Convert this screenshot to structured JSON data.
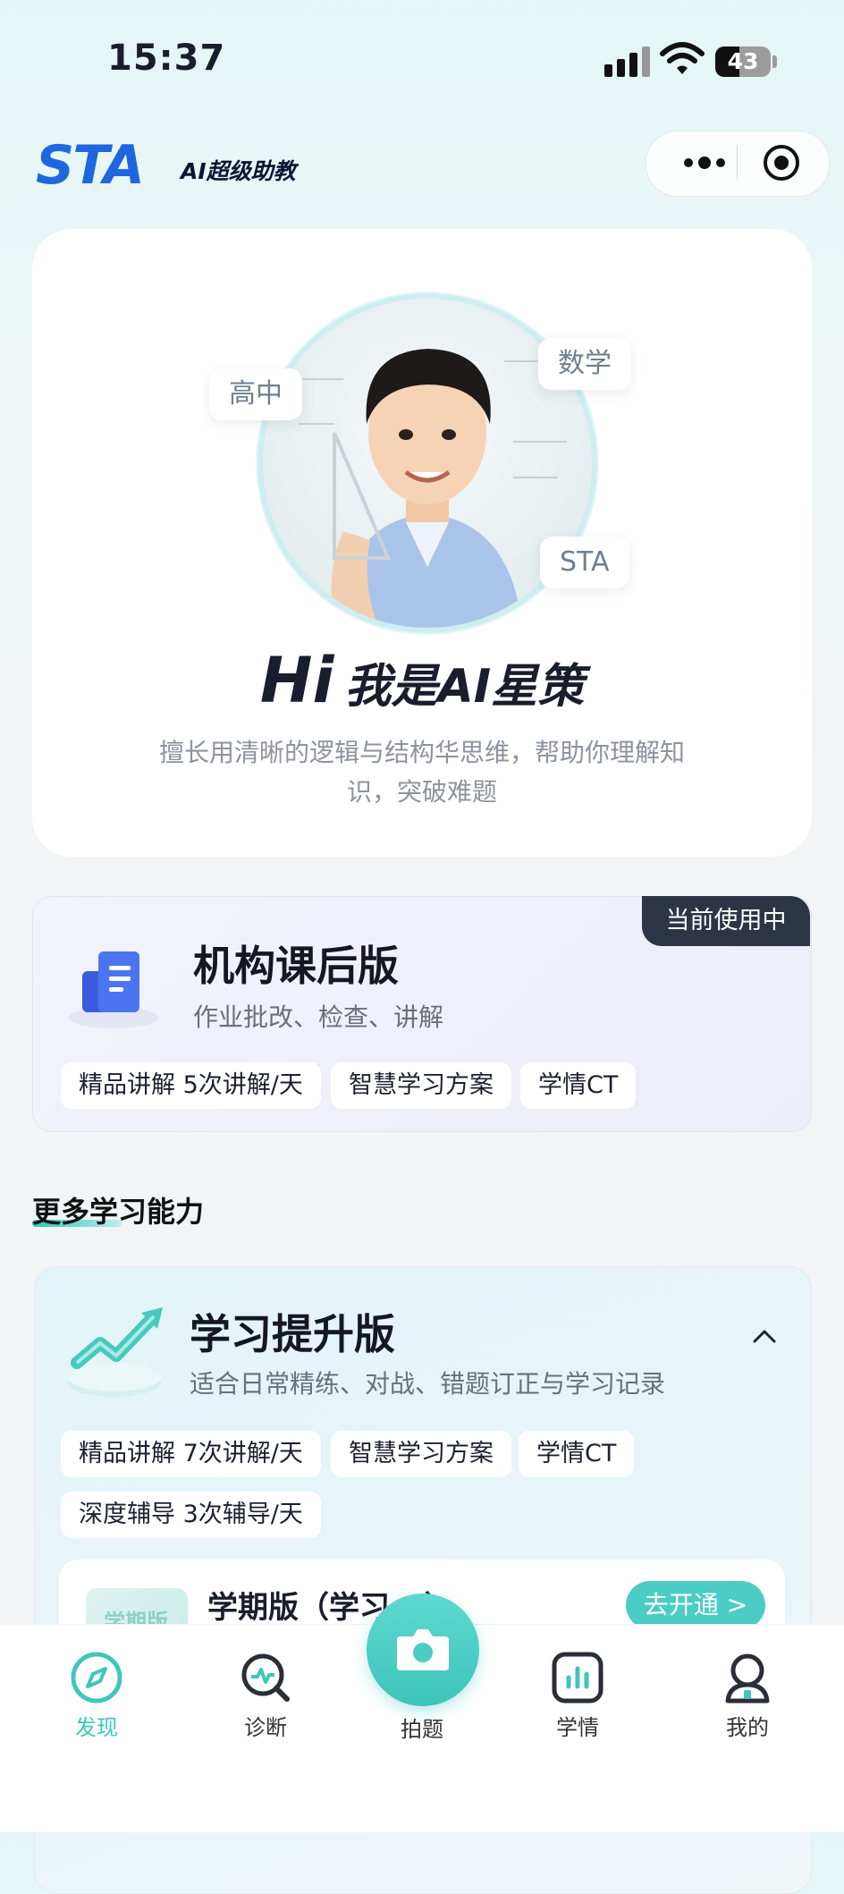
{
  "status_bar": {
    "time": "15:37",
    "battery": "43"
  },
  "header": {
    "logo": "STA",
    "logo_subtitle": "AI超级助教"
  },
  "hero": {
    "tags": [
      "高中",
      "数学",
      "STA"
    ],
    "greeting_hi": "Hi",
    "greeting_name": "我是AI星策",
    "description": "擅长用清晰的逻辑与结构华思维，帮助你理解知识，突破难题"
  },
  "org_plan": {
    "badge": "当前使用中",
    "title": "机构课后版",
    "subtitle": "作业批改、检查、讲解",
    "chips": [
      "精品讲解 5次讲解/天",
      "智慧学习方案",
      "学情CT"
    ]
  },
  "section": {
    "title": "更多学习能力"
  },
  "study_plan": {
    "title": "学习提升版",
    "subtitle": "适合日常精练、对战、错题订正与学习记录",
    "chips": [
      "精品讲解 7次讲解/天",
      "智慧学习方案",
      "学情CT",
      "深度辅导 3次辅导/天"
    ],
    "option": {
      "book_label": "学期版",
      "title": "学期版（学习...）",
      "button": "去开通 >"
    }
  },
  "tabbar": {
    "items": [
      "发现",
      "诊断",
      "拍题",
      "学情",
      "我的"
    ],
    "active_color": "#3fc6bd"
  }
}
